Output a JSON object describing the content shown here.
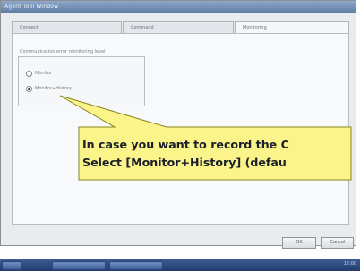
{
  "window": {
    "title": "Agent Tool Window"
  },
  "tabs": [
    {
      "label": "Connect"
    },
    {
      "label": "Command"
    },
    {
      "label": "Monitoring"
    }
  ],
  "monitoring": {
    "group_label": "Communication error monitoring level",
    "options": [
      {
        "label": "Monitor",
        "selected": false
      },
      {
        "label": "Monitor+History",
        "selected": true
      }
    ]
  },
  "callout": {
    "line1": "In case you want to record the C",
    "line2": "Select  [Monitor+History] (defau",
    "fill_color": "#fbf48a",
    "border_color": "#8a8420"
  },
  "buttons": {
    "ok": "OK",
    "cancel": "Cancel"
  },
  "taskbar": {
    "clock": "12:00"
  }
}
